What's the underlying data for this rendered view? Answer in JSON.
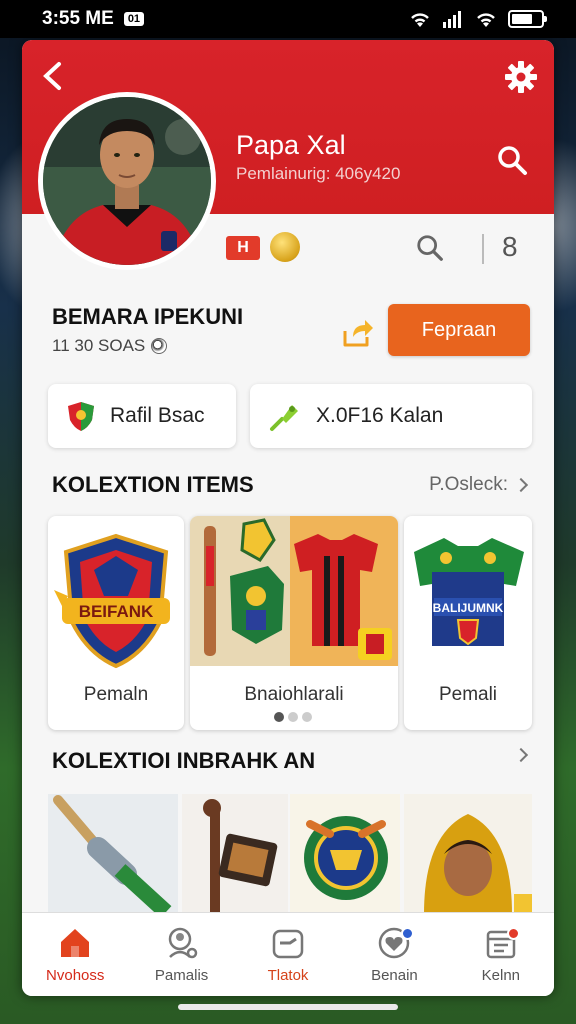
{
  "status_bar": {
    "time": "3:55 ME",
    "badge": "01"
  },
  "profile": {
    "name": "Papa Xal",
    "subtitle": "Pemlainurig: 406y420",
    "tag": "H",
    "count": "8"
  },
  "match": {
    "title": "BEMARA IPEKUNI",
    "time": "11 30 SOAS",
    "action_label": "Fepraan"
  },
  "chips": [
    {
      "label": "Rafil Bsac",
      "icon": "shield-icon"
    },
    {
      "label": "X.0F16 Kalan",
      "icon": "pin-icon"
    }
  ],
  "collection": {
    "title": "KOLEXTION ITEMS",
    "see_all": "P.Osleck:",
    "items": [
      {
        "label": "Pemaln",
        "emblem_text": "BEIFANK"
      },
      {
        "label": "Bnaiohlarali"
      },
      {
        "label": "Pemali",
        "emblem_text": "BALIJUMNK"
      }
    ]
  },
  "collection2": {
    "title": "KOLEXTIOI INBRAHK AN"
  },
  "bottom_nav": [
    {
      "label": "Nvohoss",
      "icon": "home-icon",
      "active": true
    },
    {
      "label": "Pamalis",
      "icon": "search-person-icon"
    },
    {
      "label": "Tlatok",
      "icon": "ticket-icon"
    },
    {
      "label": "Benain",
      "icon": "heart-badge-icon",
      "badge": true
    },
    {
      "label": "Kelnn",
      "icon": "calendar-icon",
      "badge": true
    }
  ],
  "colors": {
    "brand_red": "#d8232a",
    "accent_orange": "#e8641e",
    "active_nav": "#d52a1a"
  }
}
